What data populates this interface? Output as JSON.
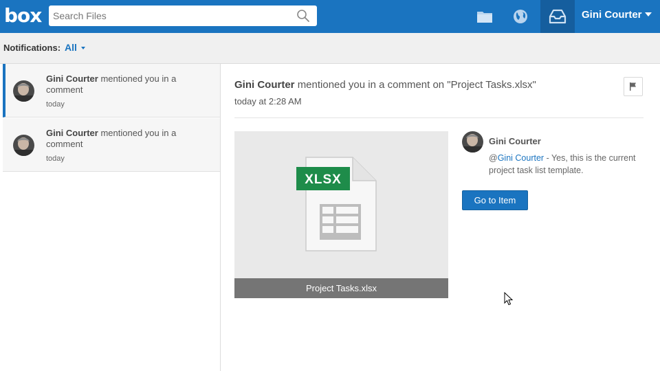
{
  "brand": {
    "logo_text": "box",
    "color": "#1a74c0"
  },
  "header": {
    "search": {
      "placeholder": "Search Files"
    },
    "nav_icons": [
      "folder-icon",
      "globe-icon",
      "inbox-icon"
    ],
    "user_name": "Gini Courter"
  },
  "subheader": {
    "label": "Notifications:",
    "filter_value": "All"
  },
  "notifications": [
    {
      "author": "Gini Courter",
      "message": "mentioned you in a comment",
      "time": "today",
      "selected": true
    },
    {
      "author": "Gini Courter",
      "message": "mentioned you in a comment",
      "time": "today",
      "selected": false
    }
  ],
  "detail": {
    "author": "Gini Courter",
    "message": "mentioned you in a comment on \"Project Tasks.xlsx\"",
    "time": "today at 2:28 AM",
    "file": {
      "badge": "XLSX",
      "name": "Project Tasks.xlsx"
    },
    "comment": {
      "author": "Gini Courter",
      "mention": "@",
      "mention_name": "Gini Courter",
      "text": " - Yes, this is the current project task list template."
    },
    "goto_label": "Go to Item"
  }
}
